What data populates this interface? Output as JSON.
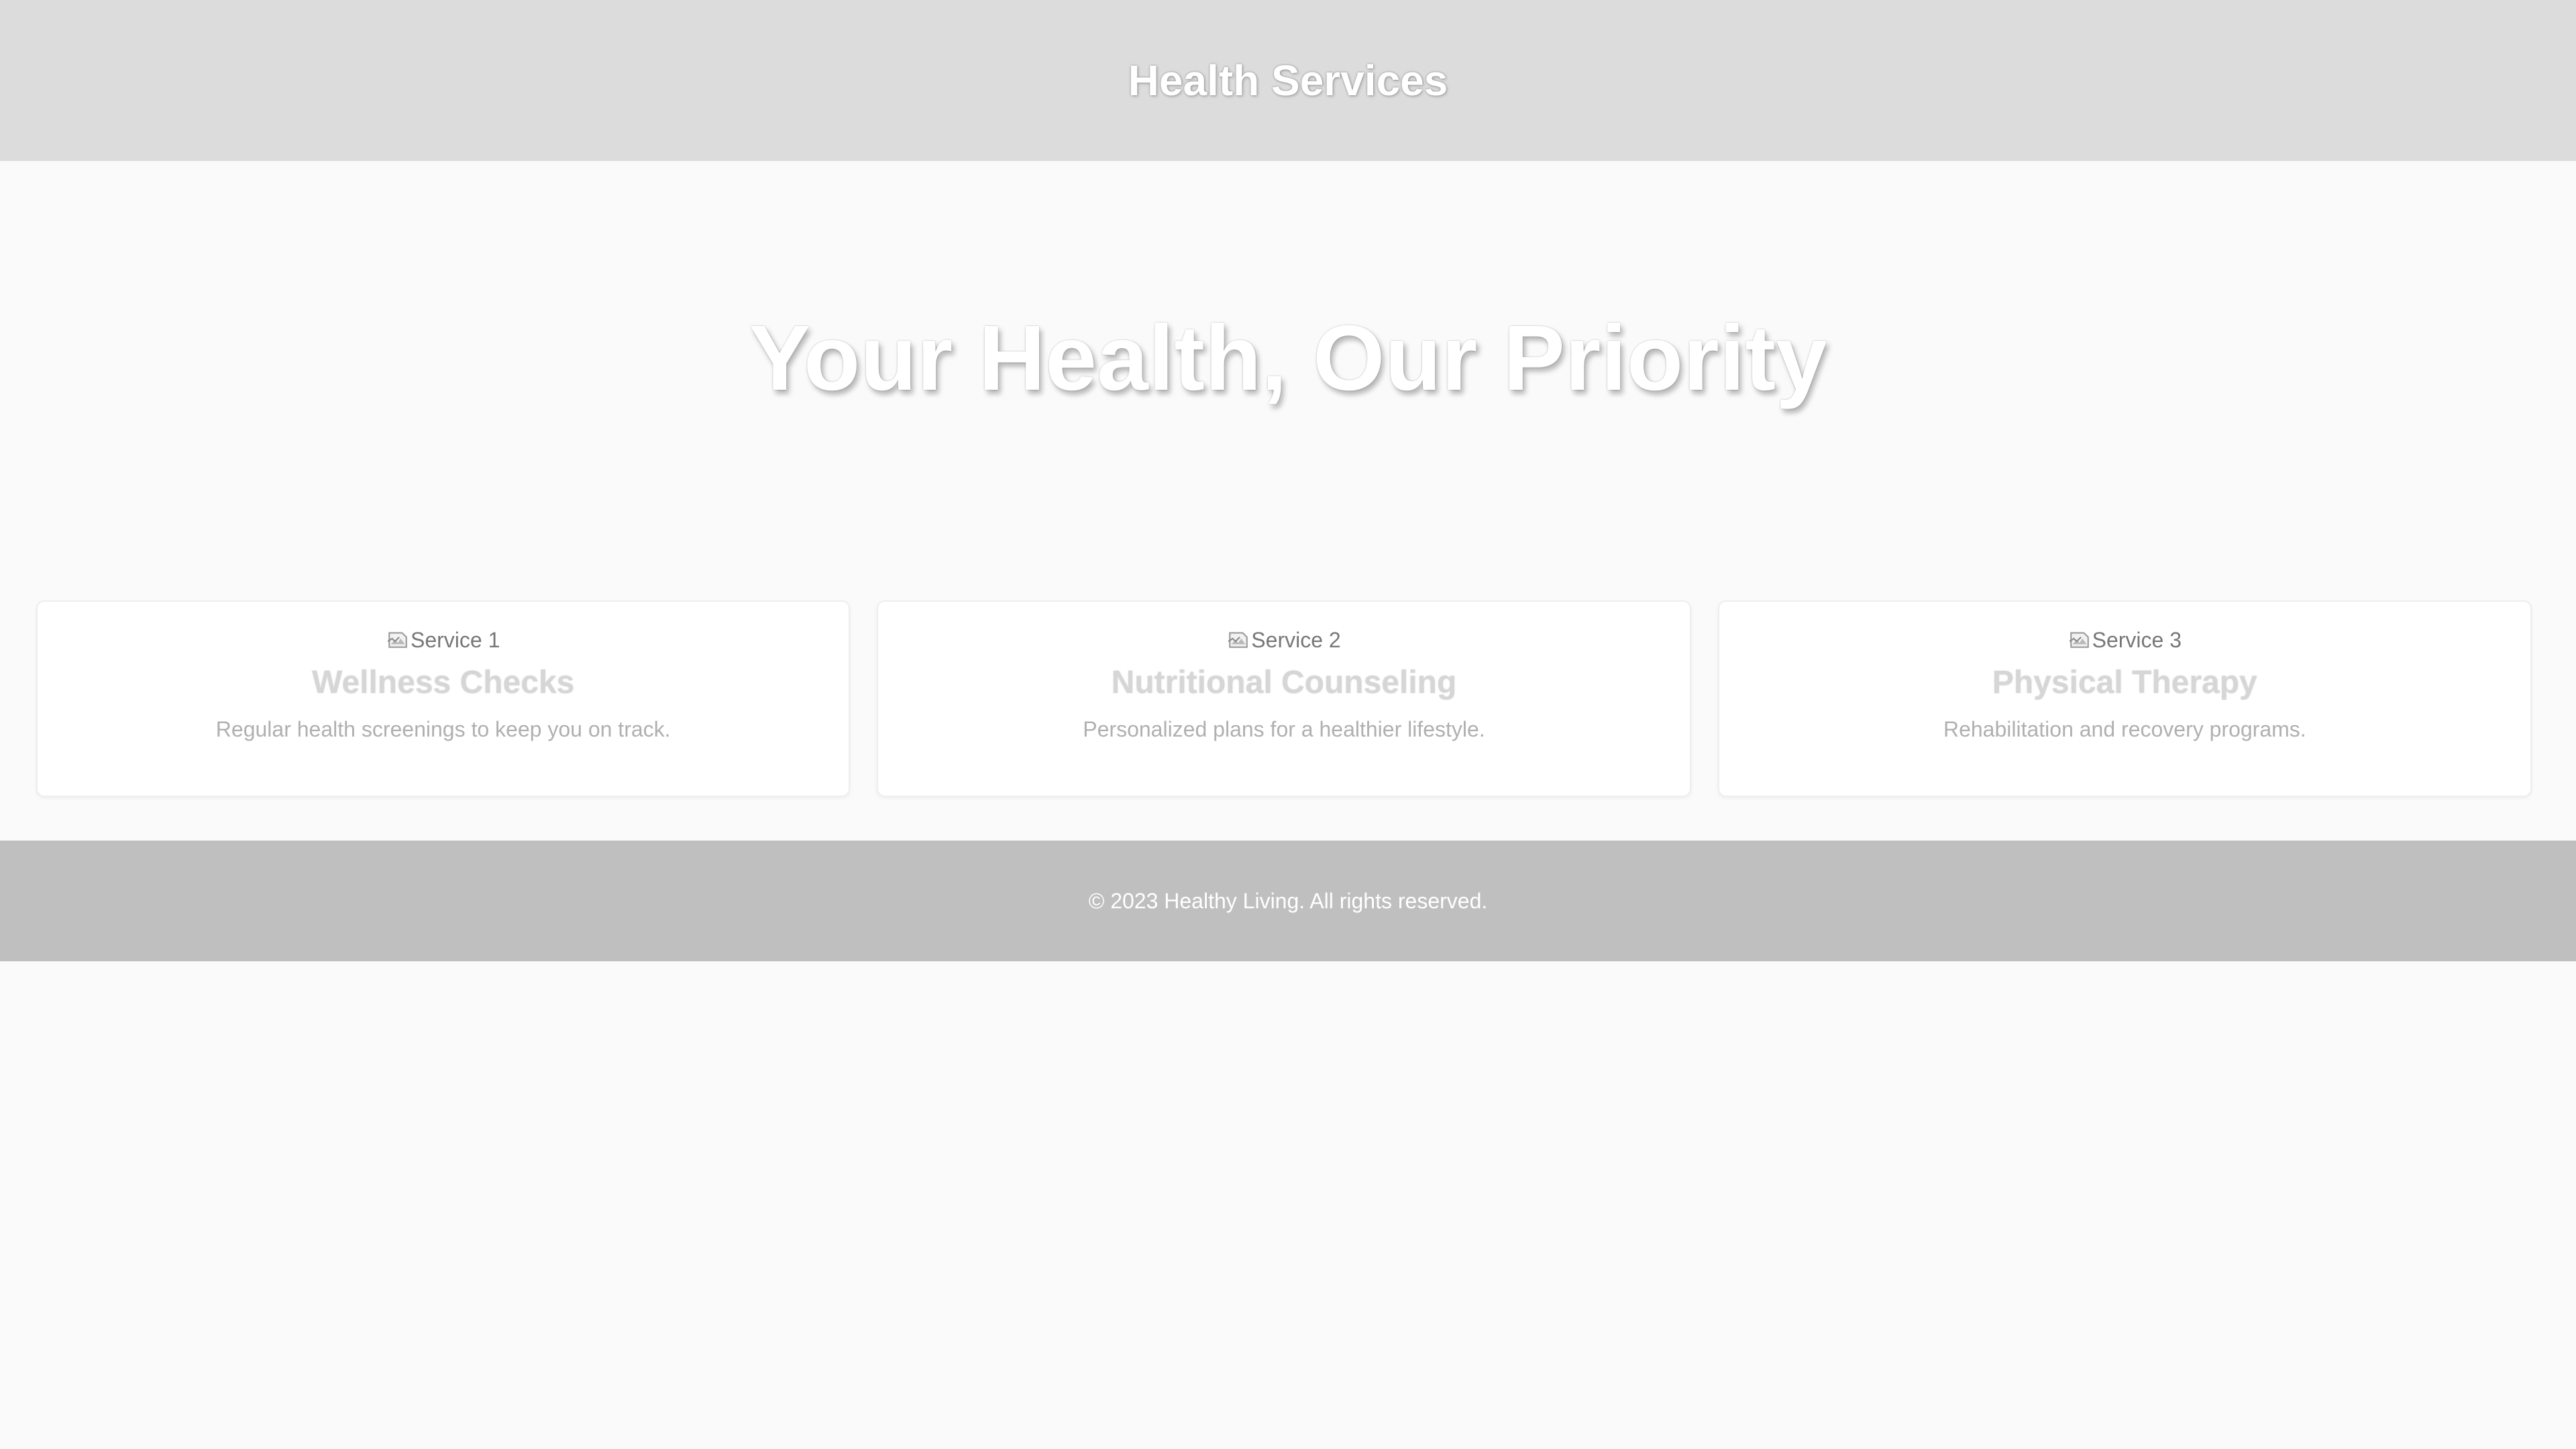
{
  "header": {
    "title": "Health Services"
  },
  "hero": {
    "heading": "Your Health, Our Priority"
  },
  "services": [
    {
      "image_alt": "Service 1",
      "title": "Wellness Checks",
      "description": "Regular health screenings to keep you on track."
    },
    {
      "image_alt": "Service 2",
      "title": "Nutritional Counseling",
      "description": "Personalized plans for a healthier lifestyle."
    },
    {
      "image_alt": "Service 3",
      "title": "Physical Therapy",
      "description": "Rehabilitation and recovery programs."
    }
  ],
  "footer": {
    "text": "© 2023 Healthy Living. All rights reserved."
  },
  "icons": {
    "service_image": "broken-image-icon"
  },
  "colors": {
    "header_bg": "#dcdcdc",
    "page_bg": "#fafafa",
    "footer_bg": "#bfbfbf",
    "heading_text": "#ffffff"
  }
}
